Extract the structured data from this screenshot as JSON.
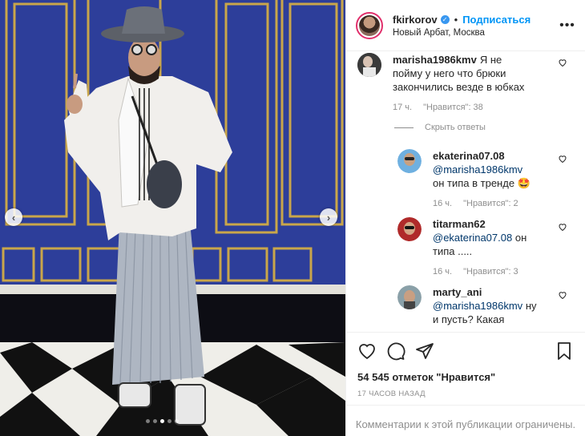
{
  "post": {
    "username": "fkirkorov",
    "follow_label": "Подписаться",
    "separator": "•",
    "location": "Новый Арбат, Москва",
    "more_icon": "more-horizontal-icon",
    "carousel": {
      "dots": 5,
      "active_index": 2,
      "prev_icon": "chevron-left-icon",
      "next_icon": "chevron-right-icon"
    }
  },
  "comments": [
    {
      "user": "marisha1986kmv",
      "text": "Я не пойму у него что брюки закончились везде в юбках",
      "time": "17 ч.",
      "likes": "\"Нравится\": 38",
      "hide_replies": "Скрыть ответы"
    },
    {
      "user": "ekaterina07.08",
      "mention": "@marisha1986kmv",
      "text": "он типа в тренде 🤩",
      "time": "16 ч.",
      "likes": "\"Нравится\": 2"
    },
    {
      "user": "titarman62",
      "mention": "@ekaterina07.08",
      "text": "он типа .....",
      "time": "16 ч.",
      "likes": "\"Нравится\": 3"
    },
    {
      "user": "marty_ani",
      "mention": "@marisha1986kmv",
      "text": "ну и пусть? Какая разница)"
    }
  ],
  "actions": {
    "likes_text": "54 545 отметок \"Нравится\"",
    "time_ago": "17 часов назад",
    "restricted": "Комментарии к этой публикации ограничены."
  },
  "colors": {
    "accent": "#0095f6",
    "verified": "#3897f0",
    "muted": "#8e8e8e",
    "wall": "#2d3e9a"
  }
}
